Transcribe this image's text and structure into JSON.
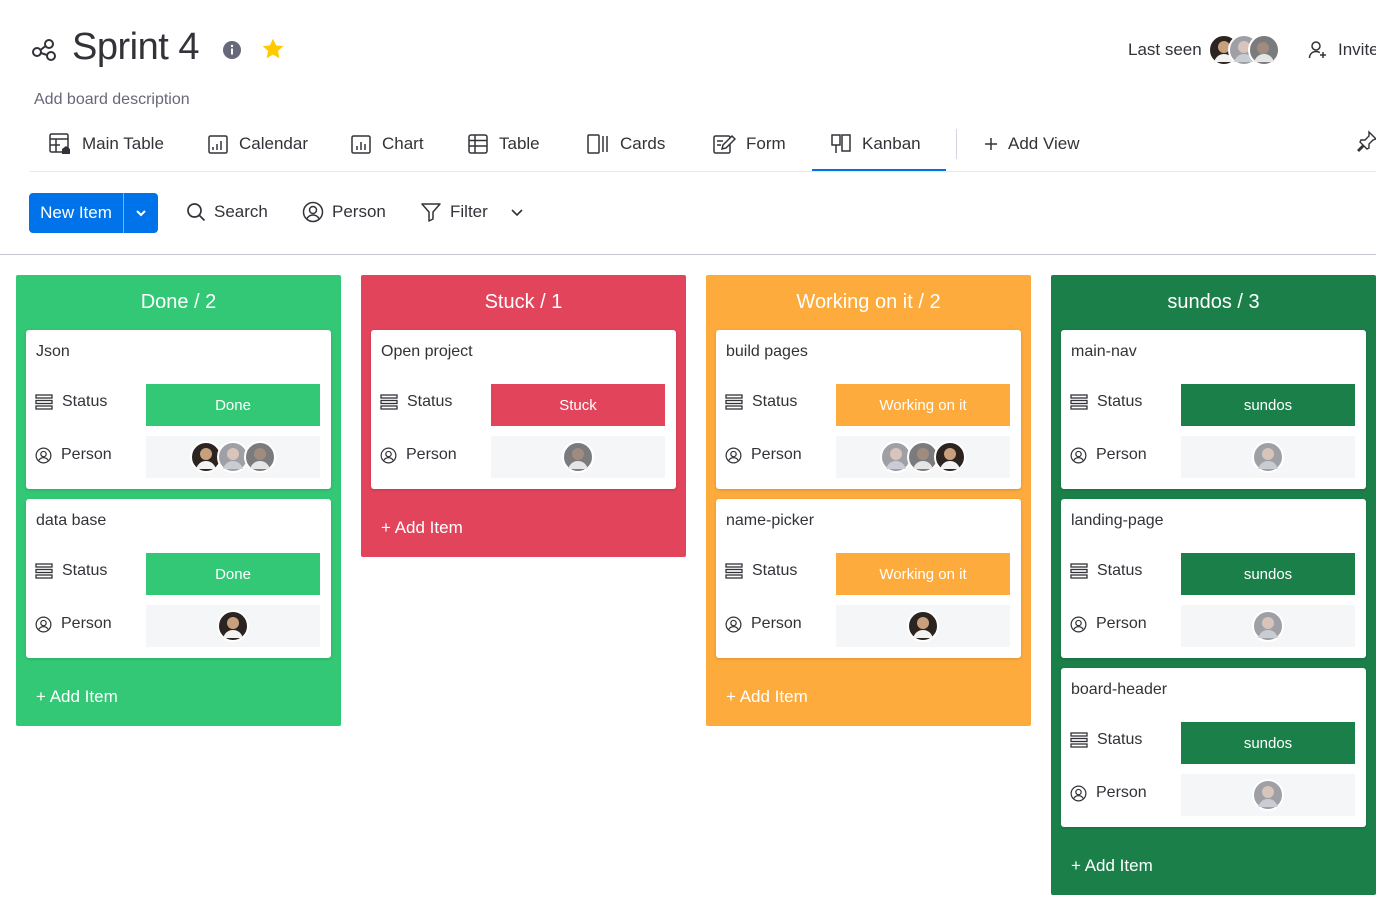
{
  "board": {
    "title": "Sprint 4",
    "description": "Add board description",
    "last_seen_label": "Last seen",
    "invite_label": "Invite"
  },
  "views": [
    {
      "label": "Main Table",
      "icon": "main-table-icon"
    },
    {
      "label": "Calendar",
      "icon": "calendar-icon"
    },
    {
      "label": "Chart",
      "icon": "chart-icon"
    },
    {
      "label": "Table",
      "icon": "table-icon"
    },
    {
      "label": "Cards",
      "icon": "cards-icon"
    },
    {
      "label": "Form",
      "icon": "form-icon"
    },
    {
      "label": "Kanban",
      "icon": "kanban-icon",
      "active": true
    },
    {
      "label": "Add View",
      "icon": "plus-icon"
    }
  ],
  "toolbar": {
    "new_item_label": "New Item",
    "search_label": "Search",
    "person_label": "Person",
    "filter_label": "Filter"
  },
  "colors": {
    "primary": "#0073ea",
    "done": "#33c875",
    "stuck": "#e2445c",
    "working": "#fdab3d",
    "sundos": "#1b7f4a"
  },
  "columns": [
    {
      "title": "Done / 2",
      "color": "#33c875",
      "add_label": "+ Add Item",
      "cards": [
        {
          "title": "Json",
          "status_label": "Status",
          "status": "Done",
          "person_label": "Person",
          "avatars": [
            "avatar-dark",
            "avatar-light",
            "avatar-gray"
          ]
        },
        {
          "title": "data base",
          "status_label": "Status",
          "status": "Done",
          "person_label": "Person",
          "avatars": [
            "avatar-dark"
          ]
        }
      ]
    },
    {
      "title": "Stuck / 1",
      "color": "#e2445c",
      "add_label": "+ Add Item",
      "cards": [
        {
          "title": "Open project",
          "status_label": "Status",
          "status": "Stuck",
          "person_label": "Person",
          "avatars": [
            "avatar-gray"
          ]
        }
      ]
    },
    {
      "title": "Working on it / 2",
      "color": "#fdab3d",
      "add_label": "+ Add Item",
      "cards": [
        {
          "title": "build pages",
          "status_label": "Status",
          "status": "Working on it",
          "person_label": "Person",
          "avatars": [
            "avatar-light",
            "avatar-gray",
            "avatar-dark"
          ]
        },
        {
          "title": "name-picker",
          "status_label": "Status",
          "status": "Working on it",
          "person_label": "Person",
          "avatars": [
            "avatar-dark"
          ]
        }
      ]
    },
    {
      "title": "sundos / 3",
      "color": "#1b7f4a",
      "add_label": "+ Add Item",
      "cards": [
        {
          "title": "main-nav",
          "status_label": "Status",
          "status": "sundos",
          "person_label": "Person",
          "avatars": [
            "avatar-light"
          ]
        },
        {
          "title": "landing-page",
          "status_label": "Status",
          "status": "sundos",
          "person_label": "Person",
          "avatars": [
            "avatar-light"
          ]
        },
        {
          "title": "board-header",
          "status_label": "Status",
          "status": "sundos",
          "person_label": "Person",
          "avatars": [
            "avatar-light"
          ]
        }
      ]
    }
  ]
}
